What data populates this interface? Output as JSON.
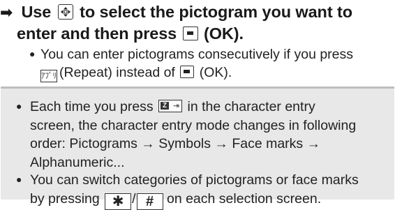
{
  "step": {
    "arrow": "➡",
    "line1_a": "Use",
    "line1_b": "to select the pictogram you want to",
    "line2_a": "enter and then press",
    "line2_b": "(OK)."
  },
  "sub_bullet": {
    "line1": "You can enter pictograms consecutively if you press",
    "repeat_key_glyph": "ｱﾌﾟﾘ",
    "line2_a": "(Repeat) instead of",
    "line2_b": "(OK)."
  },
  "notes": {
    "note1": {
      "line1_a": "Each time you press",
      "line1_b": "in the character entry",
      "line2": "screen, the character entry mode changes in following",
      "line3": "order: Pictograms → Symbols → Face marks →",
      "line4": "Alphanumeric..."
    },
    "note2": {
      "line1": "You can switch categories of pictograms or face marks",
      "line2_a": "by pressing",
      "star_key": "✱",
      "slash": "/",
      "hash_key": "#",
      "line2_b": "on each selection screen."
    }
  },
  "icons": {
    "nav_key": "navigation-key-icon",
    "ok_key": "ok-key-icon",
    "repeat_key": "repeat-key-icon",
    "mode_key": "mode-switch-key-icon",
    "star_key": "star-key-icon",
    "hash_key": "hash-key-icon"
  },
  "colors": {
    "note_background": "#e8e8e8",
    "note_border": "#bdbdbd",
    "text": "#1a1a1a"
  }
}
